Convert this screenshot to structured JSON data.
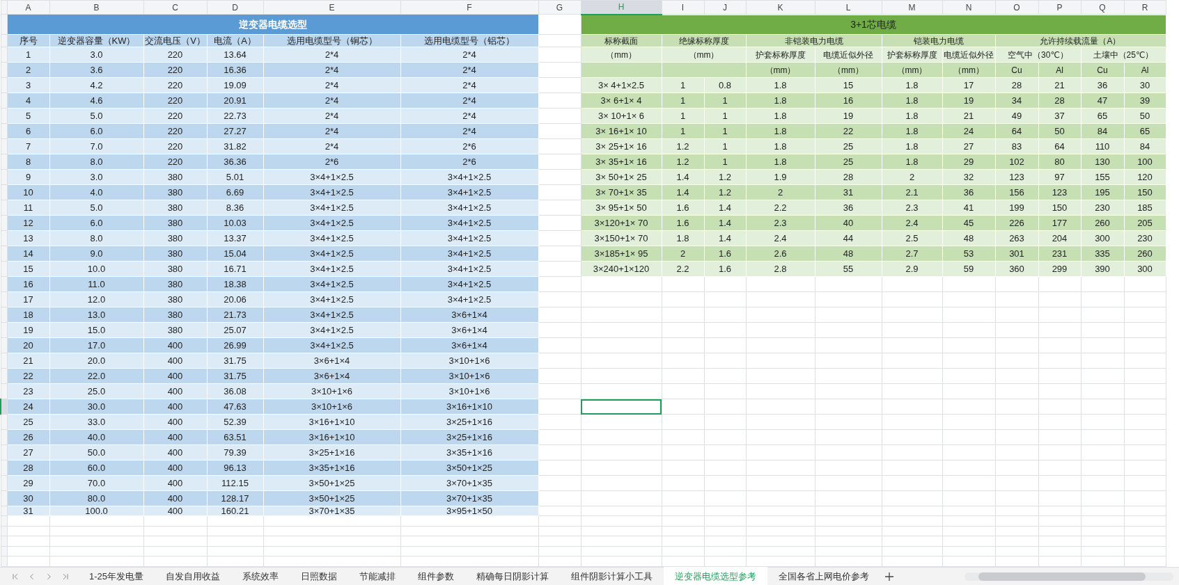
{
  "column_headers": [
    {
      "label": "A",
      "selected": false
    },
    {
      "label": "B",
      "selected": false
    },
    {
      "label": "C",
      "selected": false
    },
    {
      "label": "D",
      "selected": false
    },
    {
      "label": "E",
      "selected": false
    },
    {
      "label": "F",
      "selected": false
    },
    {
      "label": "G",
      "selected": false
    },
    {
      "label": "H",
      "selected": true
    },
    {
      "label": "I",
      "selected": false
    },
    {
      "label": "J",
      "selected": false
    },
    {
      "label": "K",
      "selected": false
    },
    {
      "label": "L",
      "selected": false
    },
    {
      "label": "M",
      "selected": false
    },
    {
      "label": "N",
      "selected": false
    },
    {
      "label": "O",
      "selected": false
    },
    {
      "label": "P",
      "selected": false
    },
    {
      "label": "Q",
      "selected": false
    },
    {
      "label": "R",
      "selected": false
    }
  ],
  "left_table": {
    "title": "逆变器电缆选型",
    "columns": [
      "序号",
      "逆变器容量（KW）",
      "交流电压（V）",
      "电流（A）",
      "选用电缆型号（铜芯）",
      "选用电缆型号（铝芯）"
    ],
    "rows": [
      {
        "cells": [
          "1",
          "3.0",
          "220",
          "13.64",
          "2*4",
          "2*4"
        ],
        "selected": false
      },
      {
        "cells": [
          "2",
          "3.6",
          "220",
          "16.36",
          "2*4",
          "2*4"
        ],
        "selected": false
      },
      {
        "cells": [
          "3",
          "4.2",
          "220",
          "19.09",
          "2*4",
          "2*4"
        ],
        "selected": false
      },
      {
        "cells": [
          "4",
          "4.6",
          "220",
          "20.91",
          "2*4",
          "2*4"
        ],
        "selected": false
      },
      {
        "cells": [
          "5",
          "5.0",
          "220",
          "22.73",
          "2*4",
          "2*4"
        ],
        "selected": false
      },
      {
        "cells": [
          "6",
          "6.0",
          "220",
          "27.27",
          "2*4",
          "2*4"
        ],
        "selected": false
      },
      {
        "cells": [
          "7",
          "7.0",
          "220",
          "31.82",
          "2*4",
          "2*6"
        ],
        "selected": false
      },
      {
        "cells": [
          "8",
          "8.0",
          "220",
          "36.36",
          "2*6",
          "2*6"
        ],
        "selected": false
      },
      {
        "cells": [
          "9",
          "3.0",
          "380",
          "5.01",
          "3×4+1×2.5",
          "3×4+1×2.5"
        ],
        "selected": false
      },
      {
        "cells": [
          "10",
          "4.0",
          "380",
          "6.69",
          "3×4+1×2.5",
          "3×4+1×2.5"
        ],
        "selected": false
      },
      {
        "cells": [
          "11",
          "5.0",
          "380",
          "8.36",
          "3×4+1×2.5",
          "3×4+1×2.5"
        ],
        "selected": false
      },
      {
        "cells": [
          "12",
          "6.0",
          "380",
          "10.03",
          "3×4+1×2.5",
          "3×4+1×2.5"
        ],
        "selected": false
      },
      {
        "cells": [
          "13",
          "8.0",
          "380",
          "13.37",
          "3×4+1×2.5",
          "3×4+1×2.5"
        ],
        "selected": false
      },
      {
        "cells": [
          "14",
          "9.0",
          "380",
          "15.04",
          "3×4+1×2.5",
          "3×4+1×2.5"
        ],
        "selected": false
      },
      {
        "cells": [
          "15",
          "10.0",
          "380",
          "16.71",
          "3×4+1×2.5",
          "3×4+1×2.5"
        ],
        "selected": false
      },
      {
        "cells": [
          "16",
          "11.0",
          "380",
          "18.38",
          "3×4+1×2.5",
          "3×4+1×2.5"
        ],
        "selected": false
      },
      {
        "cells": [
          "17",
          "12.0",
          "380",
          "20.06",
          "3×4+1×2.5",
          "3×4+1×2.5"
        ],
        "selected": false
      },
      {
        "cells": [
          "18",
          "13.0",
          "380",
          "21.73",
          "3×4+1×2.5",
          "3×6+1×4"
        ],
        "selected": false
      },
      {
        "cells": [
          "19",
          "15.0",
          "380",
          "25.07",
          "3×4+1×2.5",
          "3×6+1×4"
        ],
        "selected": false
      },
      {
        "cells": [
          "20",
          "17.0",
          "400",
          "26.99",
          "3×4+1×2.5",
          "3×6+1×4"
        ],
        "selected": false
      },
      {
        "cells": [
          "21",
          "20.0",
          "400",
          "31.75",
          "3×6+1×4",
          "3×10+1×6"
        ],
        "selected": false
      },
      {
        "cells": [
          "22",
          "22.0",
          "400",
          "31.75",
          "3×6+1×4",
          "3×10+1×6"
        ],
        "selected": false
      },
      {
        "cells": [
          "23",
          "25.0",
          "400",
          "36.08",
          "3×10+1×6",
          "3×10+1×6"
        ],
        "selected": false
      },
      {
        "cells": [
          "24",
          "30.0",
          "400",
          "47.63",
          "3×10+1×6",
          "3×16+1×10"
        ],
        "selected": true
      },
      {
        "cells": [
          "25",
          "33.0",
          "400",
          "52.39",
          "3×16+1×10",
          "3×25+1×16"
        ],
        "selected": false
      },
      {
        "cells": [
          "26",
          "40.0",
          "400",
          "63.51",
          "3×16+1×10",
          "3×25+1×16"
        ],
        "selected": false
      },
      {
        "cells": [
          "27",
          "50.0",
          "400",
          "79.39",
          "3×25+1×16",
          "3×35+1×16"
        ],
        "selected": false
      },
      {
        "cells": [
          "28",
          "60.0",
          "400",
          "96.13",
          "3×35+1×16",
          "3×50+1×25"
        ],
        "selected": false
      },
      {
        "cells": [
          "29",
          "70.0",
          "400",
          "112.15",
          "3×50+1×25",
          "3×70+1×35"
        ],
        "selected": false
      },
      {
        "cells": [
          "30",
          "80.0",
          "400",
          "128.17",
          "3×50+1×25",
          "3×70+1×35"
        ],
        "selected": false
      },
      {
        "cells": [
          "31",
          "100.0",
          "400",
          "160.21",
          "3×70+1×35",
          "3×95+1×50"
        ],
        "selected": false
      }
    ]
  },
  "right_table": {
    "title": "3+1芯电缆",
    "header_rows": [
      [
        "标称截面",
        "绝缘标称厚度",
        "非铠装电力电缆",
        "铠装电力电缆",
        "允许持续载流量（A）"
      ],
      [
        "（mm）",
        "（mm）",
        "护套标称厚度",
        "电缆近似外径",
        "护套标称厚度",
        "电缆近似外径",
        "空气中（30℃）",
        "土壤中（25℃）"
      ],
      [
        "（mm）",
        "（mm）",
        "（mm）",
        "（mm）",
        "Cu",
        "Al",
        "Cu",
        "Al"
      ]
    ],
    "rows": [
      [
        "3× 4+1×2.5",
        "1",
        "0.8",
        "1.8",
        "15",
        "1.8",
        "17",
        "28",
        "21",
        "36",
        "30"
      ],
      [
        "3× 6+1× 4",
        "1",
        "1",
        "1.8",
        "16",
        "1.8",
        "19",
        "34",
        "28",
        "47",
        "39"
      ],
      [
        "3× 10+1× 6",
        "1",
        "1",
        "1.8",
        "19",
        "1.8",
        "21",
        "49",
        "37",
        "65",
        "50"
      ],
      [
        "3× 16+1× 10",
        "1",
        "1",
        "1.8",
        "22",
        "1.8",
        "24",
        "64",
        "50",
        "84",
        "65"
      ],
      [
        "3× 25+1× 16",
        "1.2",
        "1",
        "1.8",
        "25",
        "1.8",
        "27",
        "83",
        "64",
        "110",
        "84"
      ],
      [
        "3× 35+1× 16",
        "1.2",
        "1",
        "1.8",
        "25",
        "1.8",
        "29",
        "102",
        "80",
        "130",
        "100"
      ],
      [
        "3× 50+1× 25",
        "1.4",
        "1.2",
        "1.9",
        "28",
        "2",
        "32",
        "123",
        "97",
        "155",
        "120"
      ],
      [
        "3× 70+1× 35",
        "1.4",
        "1.2",
        "2",
        "31",
        "2.1",
        "36",
        "156",
        "123",
        "195",
        "150"
      ],
      [
        "3× 95+1× 50",
        "1.6",
        "1.4",
        "2.2",
        "36",
        "2.3",
        "41",
        "199",
        "150",
        "230",
        "185"
      ],
      [
        "3×120+1× 70",
        "1.6",
        "1.4",
        "2.3",
        "40",
        "2.4",
        "45",
        "226",
        "177",
        "260",
        "205"
      ],
      [
        "3×150+1× 70",
        "1.8",
        "1.4",
        "2.4",
        "44",
        "2.5",
        "48",
        "263",
        "204",
        "300",
        "230"
      ],
      [
        "3×185+1× 95",
        "2",
        "1.6",
        "2.6",
        "48",
        "2.7",
        "53",
        "301",
        "231",
        "335",
        "260"
      ],
      [
        "3×240+1×120",
        "2.2",
        "1.6",
        "2.8",
        "55",
        "2.9",
        "59",
        "360",
        "299",
        "390",
        "300"
      ]
    ]
  },
  "sheet_tabs": [
    {
      "label": "1-25年发电量",
      "selected": false
    },
    {
      "label": "自发自用收益",
      "selected": false
    },
    {
      "label": "系统效率",
      "selected": false
    },
    {
      "label": "日照数据",
      "selected": false
    },
    {
      "label": "节能减排",
      "selected": false
    },
    {
      "label": "组件参数",
      "selected": false
    },
    {
      "label": "精确每日阴影计算",
      "selected": false
    },
    {
      "label": "组件阴影计算小工具",
      "selected": false
    },
    {
      "label": "逆变器电缆选型参考",
      "selected": true
    },
    {
      "label": "全国各省上网电价参考",
      "selected": false
    }
  ]
}
